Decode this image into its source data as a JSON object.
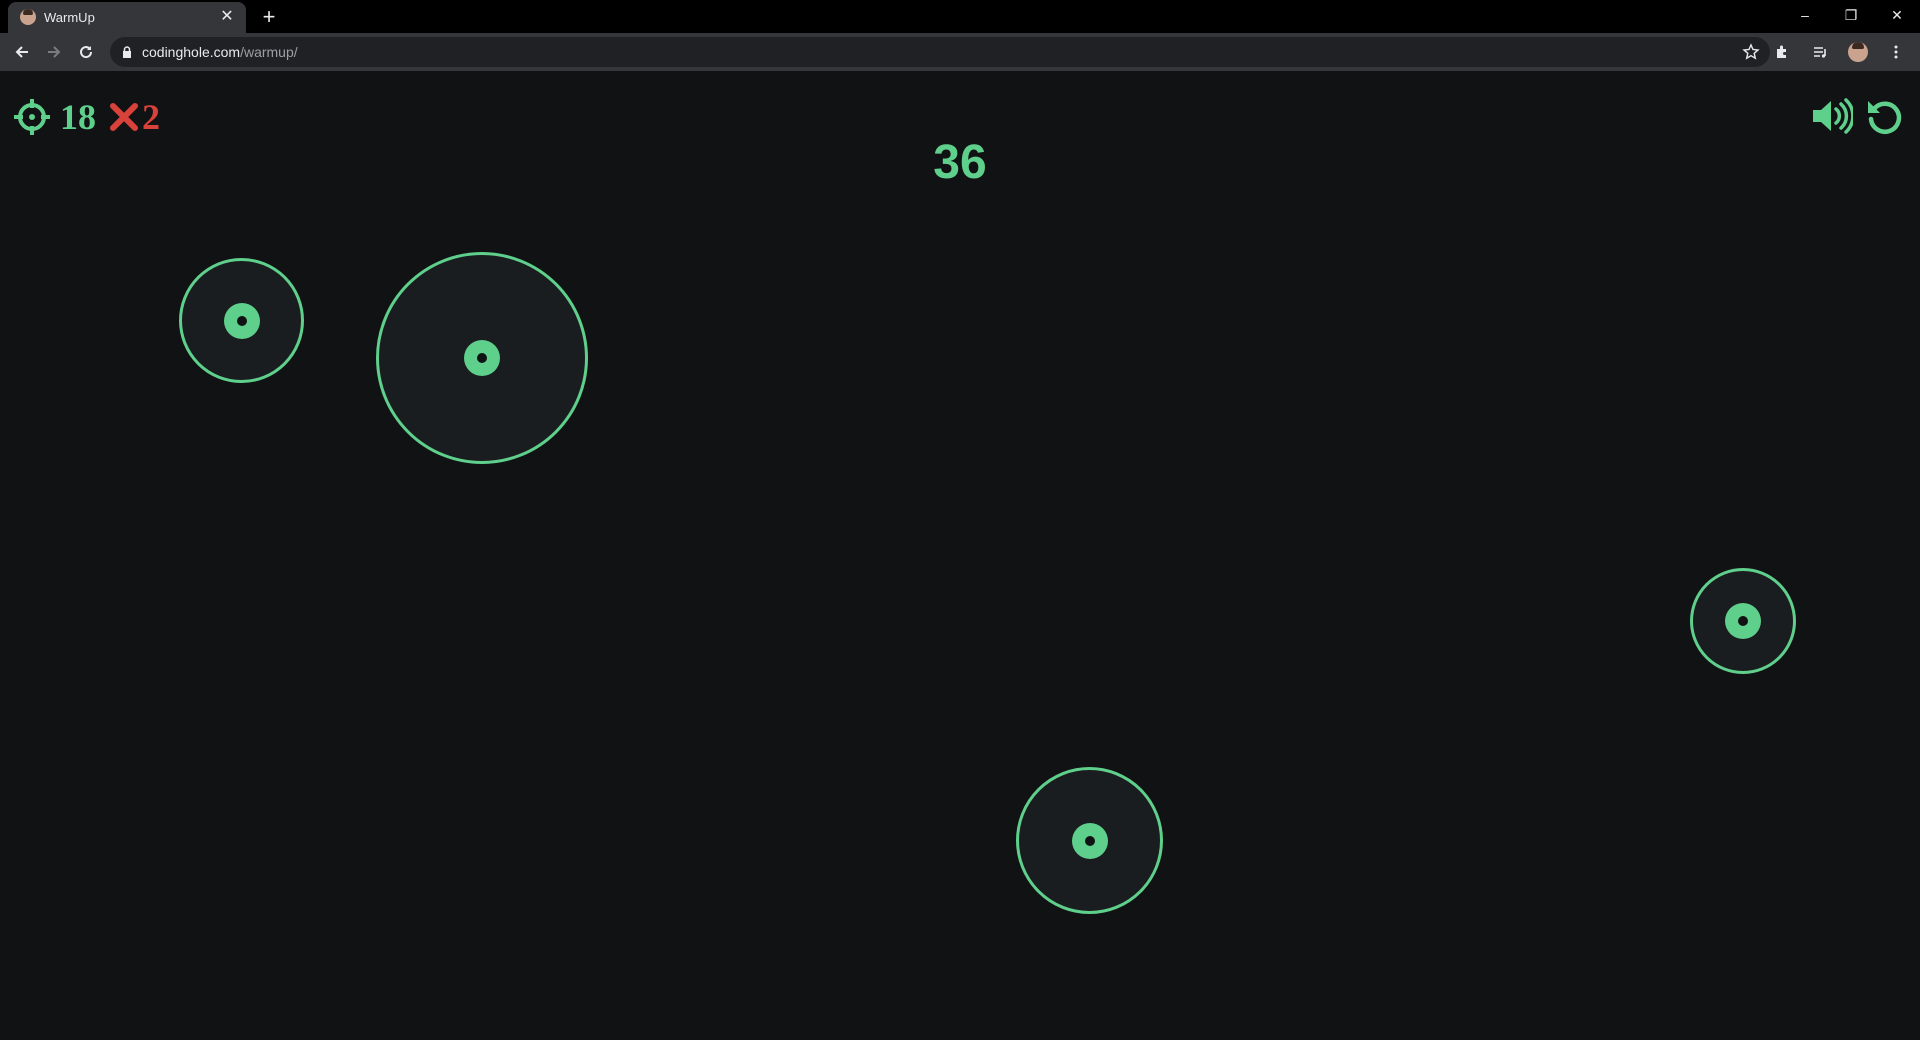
{
  "browser": {
    "tab_title": "WarmUp",
    "tab_close": "✕",
    "new_tab": "+",
    "url_host": "codinghole.com",
    "url_path": "/warmup/",
    "window_controls": [
      "–",
      "❐",
      "✕"
    ]
  },
  "hud": {
    "hits": "18",
    "misses": "2",
    "timer": "36",
    "hit_icon": "crosshair-icon",
    "miss_icon": "x-icon",
    "sound_icon": "speaker-icon",
    "restart_icon": "restart-icon"
  },
  "colors": {
    "accent": "#5fcf8c",
    "miss": "#d8423b",
    "background": "#111214",
    "target_fill": "#1a1d1f"
  },
  "targets_count": 4
}
